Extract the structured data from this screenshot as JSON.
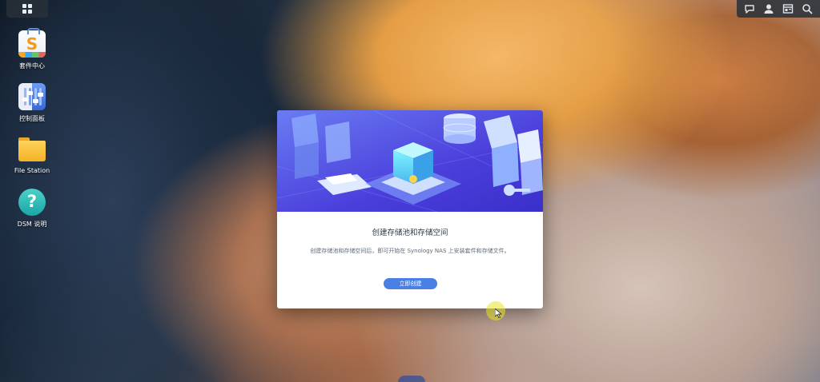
{
  "desktop": {
    "icons": [
      {
        "label": "套件中心",
        "icon": "package-center-icon"
      },
      {
        "label": "控制面板",
        "icon": "control-panel-icon"
      },
      {
        "label": "File Station",
        "icon": "folder-icon"
      },
      {
        "label": "DSM 说明",
        "icon": "help-icon"
      }
    ]
  },
  "taskbar": {
    "main_menu_icon": "grid-icon",
    "tray_icons": [
      "chat-icon",
      "user-icon",
      "widgets-icon",
      "search-icon"
    ]
  },
  "dialog": {
    "title": "创建存储池和存储空间",
    "description": "创建存储池和存储空间后，即可开始在 Synology NAS 上安装套件和存储文件。",
    "button_label": "立即创建"
  },
  "colors": {
    "accent": "#4a7fe3",
    "banner": "#5b4de0"
  }
}
